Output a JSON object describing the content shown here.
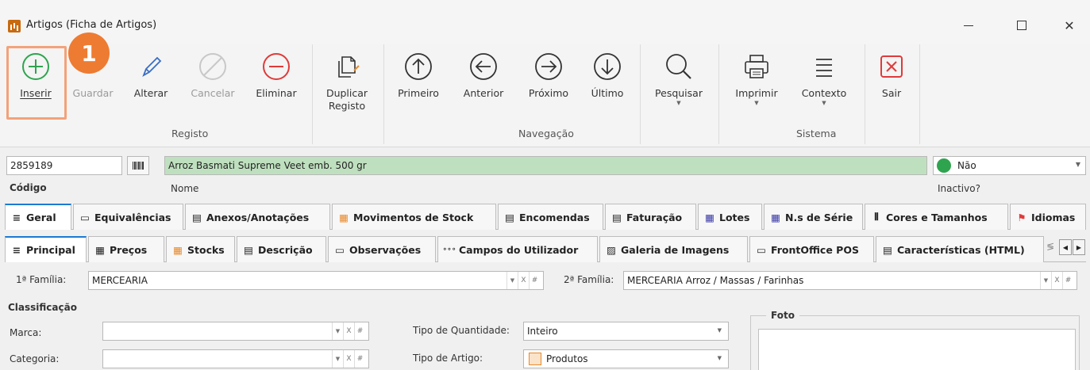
{
  "window": {
    "title": "Artigos (Ficha de Artigos)",
    "min_glyph": "",
    "close_glyph": "✕"
  },
  "ribbon": {
    "badge": "1",
    "buttons": {
      "inserir": "Inserir",
      "guardar": "Guardar",
      "alterar": "Alterar",
      "cancelar": "Cancelar",
      "eliminar": "Eliminar",
      "duplicar_l1": "Duplicar",
      "duplicar_l2": "Registo",
      "primeiro": "Primeiro",
      "anterior": "Anterior",
      "proximo": "Próximo",
      "ultimo": "Último",
      "pesquisar": "Pesquisar",
      "imprimir": "Imprimir",
      "contexto": "Contexto",
      "sair": "Sair"
    },
    "groups": {
      "registo": "Registo",
      "navegacao": "Navegação",
      "sistema": "Sistema"
    },
    "colors": {
      "green": "#2ea44f",
      "red": "#e03a3a",
      "blue": "#3a6fc4",
      "dark": "#333333",
      "disabled": "#bbbbbb"
    }
  },
  "record": {
    "codigo_value": "2859189",
    "codigo_label": "Código",
    "nome_value": "Arroz Basmati Supreme Veet emb. 500 gr",
    "nome_label": "Nome",
    "inactivo_value": "Não",
    "inactivo_label": "Inactivo?",
    "nome_bg": "#bfe0bf"
  },
  "tabs_main": [
    {
      "label": "Geral",
      "icon": "lines-icon"
    },
    {
      "label": "Equivalências",
      "icon": "window-icon"
    },
    {
      "label": "Anexos/Anotações",
      "icon": "note-icon"
    },
    {
      "label": "Movimentos de Stock",
      "icon": "stock-icon"
    },
    {
      "label": "Encomendas",
      "icon": "doc-icon"
    },
    {
      "label": "Faturação",
      "icon": "doc-icon"
    },
    {
      "label": "Lotes",
      "icon": "grid-icon"
    },
    {
      "label": "N.s de Série",
      "icon": "grid-icon"
    },
    {
      "label": "Cores e Tamanhos",
      "icon": "barcode-icon"
    },
    {
      "label": "Idiomas",
      "icon": "flag-icon"
    }
  ],
  "tabs_sub": [
    {
      "label": "Principal",
      "icon": "lines-icon"
    },
    {
      "label": "Preços",
      "icon": "calc-icon"
    },
    {
      "label": "Stocks",
      "icon": "stock-icon"
    },
    {
      "label": "Descrição",
      "icon": "list-icon"
    },
    {
      "label": "Observações",
      "icon": "comment-icon"
    },
    {
      "label": "Campos do Utilizador",
      "icon": "dots-icon"
    },
    {
      "label": "Galeria de Imagens",
      "icon": "image-icon"
    },
    {
      "label": "FrontOffice POS",
      "icon": "laptop-icon"
    },
    {
      "label": "Características (HTML)",
      "icon": "html-icon"
    }
  ],
  "form": {
    "familia1_label": "1ª Família:",
    "familia1_value": "MERCEARIA",
    "familia2_label": "2ª Família:",
    "familia2_value": "MERCEARIA Arroz / Massas / Farinhas",
    "classificacao": "Classificação",
    "marca_label": "Marca:",
    "marca_value": "",
    "categoria_label": "Categoria:",
    "categoria_value": "",
    "tipo_qtd_label": "Tipo de Quantidade:",
    "tipo_qtd_value": "Inteiro",
    "tipo_artigo_label": "Tipo de Artigo:",
    "tipo_artigo_value": "Produtos",
    "foto_label": "Foto",
    "combo_arrow": "▼",
    "combo_clear": "X",
    "combo_hash": "#"
  }
}
